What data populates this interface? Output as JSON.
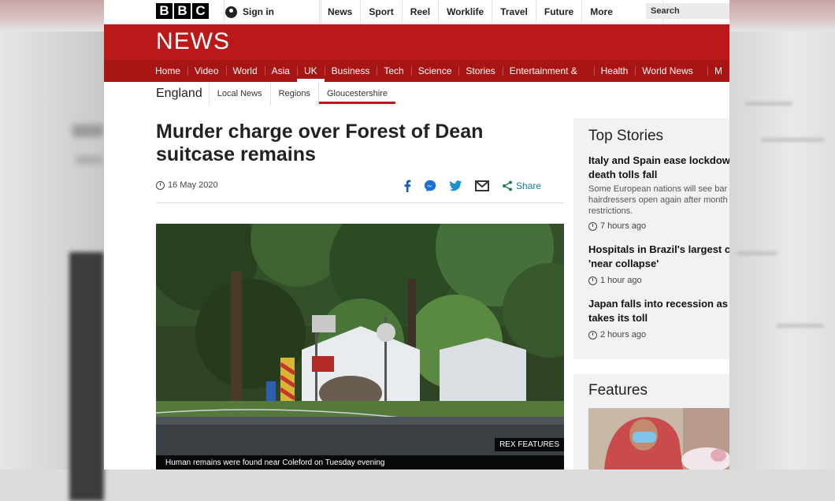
{
  "brand": {
    "logo_letters": [
      "B",
      "B",
      "C"
    ],
    "news_logo": "NEWS",
    "red": "#bb1919"
  },
  "topbar": {
    "sign_in": "Sign in",
    "nav": [
      "News",
      "Sport",
      "Reel",
      "Worklife",
      "Travel",
      "Future"
    ],
    "more": "More",
    "search_placeholder": "Search"
  },
  "main_nav": {
    "items": [
      "Home",
      "Video",
      "World",
      "Asia",
      "UK",
      "Business",
      "Tech",
      "Science",
      "Stories",
      "Entertainment & Arts",
      "Health",
      "World News TV",
      "M"
    ],
    "active": "UK"
  },
  "sub_nav": {
    "region": "England",
    "items": [
      "Local News",
      "Regions",
      "Gloucestershire"
    ],
    "active": "Gloucestershire"
  },
  "article": {
    "headline": "Murder charge over Forest of Dean suitcase remains",
    "date": "16 May 2020",
    "share_label": "Share",
    "image_credit": "REX FEATURES",
    "image_caption": "Human remains were found near Coleford on Tuesday evening"
  },
  "top_stories": {
    "heading": "Top Stories",
    "stories": [
      {
        "title_lines": [
          "Italy and Spain ease lockdown",
          "death tolls fall"
        ],
        "summary_lines": [
          "Some European nations will see bar",
          "hairdressers open again after month",
          "restrictions."
        ],
        "time": "7 hours ago"
      },
      {
        "title_lines": [
          "Hospitals in Brazil's largest ci",
          "'near collapse'"
        ],
        "summary_lines": [],
        "time": "1 hour ago"
      },
      {
        "title_lines": [
          "Japan falls into recession as",
          "takes its toll"
        ],
        "summary_lines": [],
        "time": "2 hours ago"
      }
    ]
  },
  "features": {
    "heading": "Features"
  }
}
